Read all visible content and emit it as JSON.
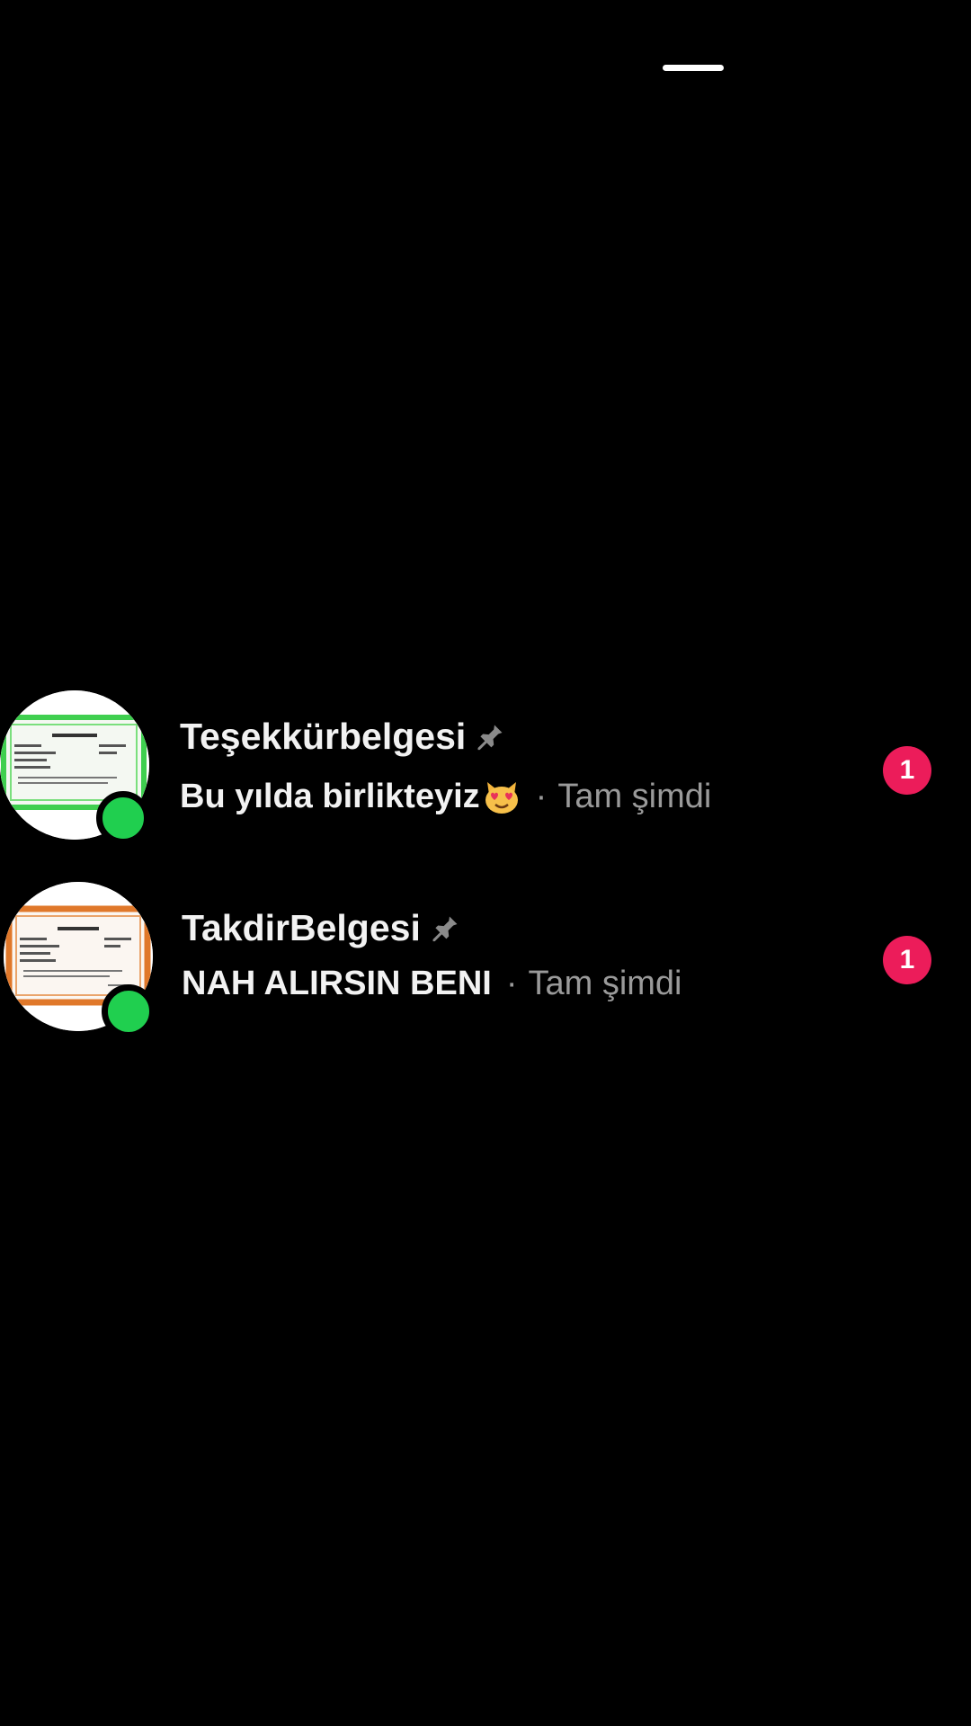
{
  "chats": [
    {
      "name": "Teşekkürbelgesi",
      "message": "Bu yılda birlikteyiz",
      "emoji": "heart-eyes-cat-icon",
      "separator": "·",
      "time": "Tam şimdi",
      "unread": "1",
      "pinned": true,
      "online": true,
      "avatar_frame_color": "#3fcf4f"
    },
    {
      "name": "TakdirBelgesi",
      "message": "NAH ALIRSIN BENI",
      "separator": "·",
      "time": "Tam şimdi",
      "unread": "1",
      "pinned": true,
      "online": true,
      "avatar_frame_color": "#e0782a"
    }
  ],
  "colors": {
    "background": "#000000",
    "online": "#20cf4f",
    "badge": "#ec1c5a",
    "secondary_text": "#9a9a9a"
  }
}
